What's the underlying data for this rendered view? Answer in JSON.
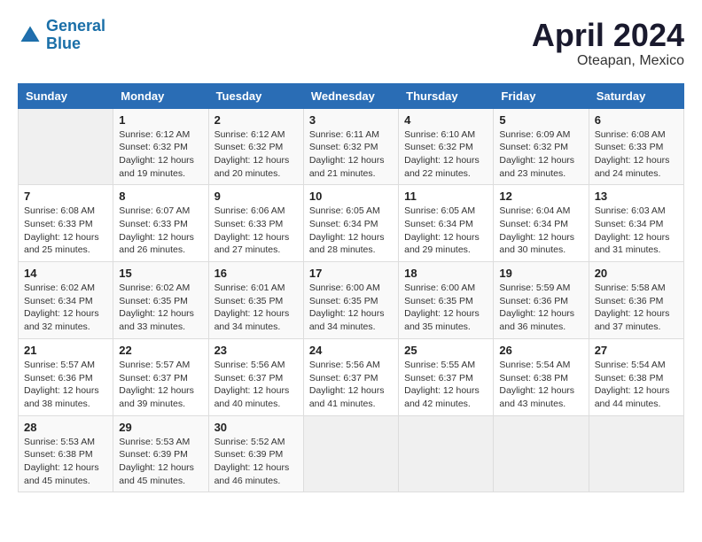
{
  "header": {
    "logo_line1": "General",
    "logo_line2": "Blue",
    "month": "April 2024",
    "location": "Oteapan, Mexico"
  },
  "days_of_week": [
    "Sunday",
    "Monday",
    "Tuesday",
    "Wednesday",
    "Thursday",
    "Friday",
    "Saturday"
  ],
  "weeks": [
    [
      {
        "day": "",
        "info": ""
      },
      {
        "day": "1",
        "info": "Sunrise: 6:12 AM\nSunset: 6:32 PM\nDaylight: 12 hours\nand 19 minutes."
      },
      {
        "day": "2",
        "info": "Sunrise: 6:12 AM\nSunset: 6:32 PM\nDaylight: 12 hours\nand 20 minutes."
      },
      {
        "day": "3",
        "info": "Sunrise: 6:11 AM\nSunset: 6:32 PM\nDaylight: 12 hours\nand 21 minutes."
      },
      {
        "day": "4",
        "info": "Sunrise: 6:10 AM\nSunset: 6:32 PM\nDaylight: 12 hours\nand 22 minutes."
      },
      {
        "day": "5",
        "info": "Sunrise: 6:09 AM\nSunset: 6:32 PM\nDaylight: 12 hours\nand 23 minutes."
      },
      {
        "day": "6",
        "info": "Sunrise: 6:08 AM\nSunset: 6:33 PM\nDaylight: 12 hours\nand 24 minutes."
      }
    ],
    [
      {
        "day": "7",
        "info": "Sunrise: 6:08 AM\nSunset: 6:33 PM\nDaylight: 12 hours\nand 25 minutes."
      },
      {
        "day": "8",
        "info": "Sunrise: 6:07 AM\nSunset: 6:33 PM\nDaylight: 12 hours\nand 26 minutes."
      },
      {
        "day": "9",
        "info": "Sunrise: 6:06 AM\nSunset: 6:33 PM\nDaylight: 12 hours\nand 27 minutes."
      },
      {
        "day": "10",
        "info": "Sunrise: 6:05 AM\nSunset: 6:34 PM\nDaylight: 12 hours\nand 28 minutes."
      },
      {
        "day": "11",
        "info": "Sunrise: 6:05 AM\nSunset: 6:34 PM\nDaylight: 12 hours\nand 29 minutes."
      },
      {
        "day": "12",
        "info": "Sunrise: 6:04 AM\nSunset: 6:34 PM\nDaylight: 12 hours\nand 30 minutes."
      },
      {
        "day": "13",
        "info": "Sunrise: 6:03 AM\nSunset: 6:34 PM\nDaylight: 12 hours\nand 31 minutes."
      }
    ],
    [
      {
        "day": "14",
        "info": "Sunrise: 6:02 AM\nSunset: 6:34 PM\nDaylight: 12 hours\nand 32 minutes."
      },
      {
        "day": "15",
        "info": "Sunrise: 6:02 AM\nSunset: 6:35 PM\nDaylight: 12 hours\nand 33 minutes."
      },
      {
        "day": "16",
        "info": "Sunrise: 6:01 AM\nSunset: 6:35 PM\nDaylight: 12 hours\nand 34 minutes."
      },
      {
        "day": "17",
        "info": "Sunrise: 6:00 AM\nSunset: 6:35 PM\nDaylight: 12 hours\nand 34 minutes."
      },
      {
        "day": "18",
        "info": "Sunrise: 6:00 AM\nSunset: 6:35 PM\nDaylight: 12 hours\nand 35 minutes."
      },
      {
        "day": "19",
        "info": "Sunrise: 5:59 AM\nSunset: 6:36 PM\nDaylight: 12 hours\nand 36 minutes."
      },
      {
        "day": "20",
        "info": "Sunrise: 5:58 AM\nSunset: 6:36 PM\nDaylight: 12 hours\nand 37 minutes."
      }
    ],
    [
      {
        "day": "21",
        "info": "Sunrise: 5:57 AM\nSunset: 6:36 PM\nDaylight: 12 hours\nand 38 minutes."
      },
      {
        "day": "22",
        "info": "Sunrise: 5:57 AM\nSunset: 6:37 PM\nDaylight: 12 hours\nand 39 minutes."
      },
      {
        "day": "23",
        "info": "Sunrise: 5:56 AM\nSunset: 6:37 PM\nDaylight: 12 hours\nand 40 minutes."
      },
      {
        "day": "24",
        "info": "Sunrise: 5:56 AM\nSunset: 6:37 PM\nDaylight: 12 hours\nand 41 minutes."
      },
      {
        "day": "25",
        "info": "Sunrise: 5:55 AM\nSunset: 6:37 PM\nDaylight: 12 hours\nand 42 minutes."
      },
      {
        "day": "26",
        "info": "Sunrise: 5:54 AM\nSunset: 6:38 PM\nDaylight: 12 hours\nand 43 minutes."
      },
      {
        "day": "27",
        "info": "Sunrise: 5:54 AM\nSunset: 6:38 PM\nDaylight: 12 hours\nand 44 minutes."
      }
    ],
    [
      {
        "day": "28",
        "info": "Sunrise: 5:53 AM\nSunset: 6:38 PM\nDaylight: 12 hours\nand 45 minutes."
      },
      {
        "day": "29",
        "info": "Sunrise: 5:53 AM\nSunset: 6:39 PM\nDaylight: 12 hours\nand 45 minutes."
      },
      {
        "day": "30",
        "info": "Sunrise: 5:52 AM\nSunset: 6:39 PM\nDaylight: 12 hours\nand 46 minutes."
      },
      {
        "day": "",
        "info": ""
      },
      {
        "day": "",
        "info": ""
      },
      {
        "day": "",
        "info": ""
      },
      {
        "day": "",
        "info": ""
      }
    ]
  ]
}
